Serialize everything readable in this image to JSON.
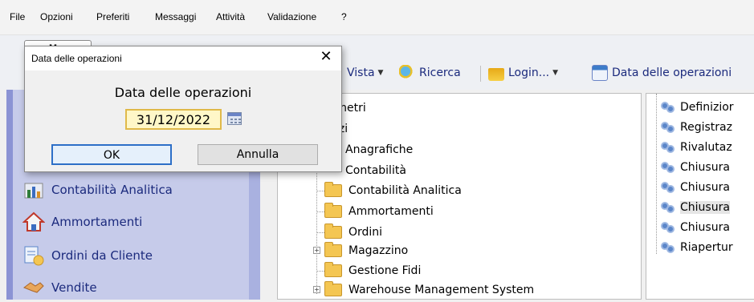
{
  "menubar": {
    "items": [
      "File",
      "Opzioni",
      "Preferiti",
      "Messaggi",
      "Attività",
      "Validazione",
      "?"
    ]
  },
  "tab": {
    "label": "Menu"
  },
  "toolbar": {
    "vista": "Vista",
    "ricerca": "Ricerca",
    "login": "Login...",
    "data_operazioni": "Data delle operazioni"
  },
  "leftnav": {
    "items": [
      {
        "label": "Contabilità Analitica",
        "icon": "chart-icon"
      },
      {
        "label": "Ammortamenti",
        "icon": "house-icon"
      },
      {
        "label": "Ordini da Cliente",
        "icon": "orders-icon"
      },
      {
        "label": "Vendite",
        "icon": "handshake-icon"
      }
    ]
  },
  "tree": {
    "items": [
      "rametri",
      "rvizi",
      "Anagrafiche",
      "Contabilità",
      "Contabilità Analitica",
      "Ammortamenti",
      "Ordini",
      "Magazzino",
      "Gestione Fidi",
      "Warehouse Management System"
    ]
  },
  "rightpanel": {
    "items": [
      "Definizior",
      "Registraz",
      "Rivalutaz",
      "Chiusura",
      "Chiusura",
      "Chiusura",
      "Chiusura",
      "Riapertur"
    ],
    "selected_index": 5
  },
  "dialog": {
    "title": "Data delle operazioni",
    "close": "✕",
    "label": "Data delle operazioni",
    "date_value": "31/12/2022",
    "ok": "OK",
    "cancel": "Annulla"
  },
  "colors": {
    "nav_bg": "#c6cbea",
    "nav_text": "#1b2a7d",
    "input_bg": "#fff7c8",
    "ok_border": "#2d6fc7"
  }
}
